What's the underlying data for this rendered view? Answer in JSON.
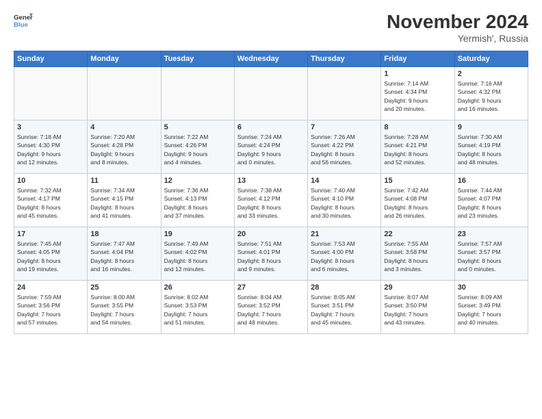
{
  "logo": {
    "line1": "General",
    "line2": "Blue"
  },
  "title": "November 2024",
  "subtitle": "Yermish', Russia",
  "days_of_week": [
    "Sunday",
    "Monday",
    "Tuesday",
    "Wednesday",
    "Thursday",
    "Friday",
    "Saturday"
  ],
  "weeks": [
    [
      {
        "num": "",
        "info": ""
      },
      {
        "num": "",
        "info": ""
      },
      {
        "num": "",
        "info": ""
      },
      {
        "num": "",
        "info": ""
      },
      {
        "num": "",
        "info": ""
      },
      {
        "num": "1",
        "info": "Sunrise: 7:14 AM\nSunset: 4:34 PM\nDaylight: 9 hours\nand 20 minutes."
      },
      {
        "num": "2",
        "info": "Sunrise: 7:16 AM\nSunset: 4:32 PM\nDaylight: 9 hours\nand 16 minutes."
      }
    ],
    [
      {
        "num": "3",
        "info": "Sunrise: 7:18 AM\nSunset: 4:30 PM\nDaylight: 9 hours\nand 12 minutes."
      },
      {
        "num": "4",
        "info": "Sunrise: 7:20 AM\nSunset: 4:28 PM\nDaylight: 9 hours\nand 8 minutes."
      },
      {
        "num": "5",
        "info": "Sunrise: 7:22 AM\nSunset: 4:26 PM\nDaylight: 9 hours\nand 4 minutes."
      },
      {
        "num": "6",
        "info": "Sunrise: 7:24 AM\nSunset: 4:24 PM\nDaylight: 9 hours\nand 0 minutes."
      },
      {
        "num": "7",
        "info": "Sunrise: 7:26 AM\nSunset: 4:22 PM\nDaylight: 8 hours\nand 56 minutes."
      },
      {
        "num": "8",
        "info": "Sunrise: 7:28 AM\nSunset: 4:21 PM\nDaylight: 8 hours\nand 52 minutes."
      },
      {
        "num": "9",
        "info": "Sunrise: 7:30 AM\nSunset: 4:19 PM\nDaylight: 8 hours\nand 48 minutes."
      }
    ],
    [
      {
        "num": "10",
        "info": "Sunrise: 7:32 AM\nSunset: 4:17 PM\nDaylight: 8 hours\nand 45 minutes."
      },
      {
        "num": "11",
        "info": "Sunrise: 7:34 AM\nSunset: 4:15 PM\nDaylight: 8 hours\nand 41 minutes."
      },
      {
        "num": "12",
        "info": "Sunrise: 7:36 AM\nSunset: 4:13 PM\nDaylight: 8 hours\nand 37 minutes."
      },
      {
        "num": "13",
        "info": "Sunrise: 7:38 AM\nSunset: 4:12 PM\nDaylight: 8 hours\nand 33 minutes."
      },
      {
        "num": "14",
        "info": "Sunrise: 7:40 AM\nSunset: 4:10 PM\nDaylight: 8 hours\nand 30 minutes."
      },
      {
        "num": "15",
        "info": "Sunrise: 7:42 AM\nSunset: 4:08 PM\nDaylight: 8 hours\nand 26 minutes."
      },
      {
        "num": "16",
        "info": "Sunrise: 7:44 AM\nSunset: 4:07 PM\nDaylight: 8 hours\nand 23 minutes."
      }
    ],
    [
      {
        "num": "17",
        "info": "Sunrise: 7:45 AM\nSunset: 4:05 PM\nDaylight: 8 hours\nand 19 minutes."
      },
      {
        "num": "18",
        "info": "Sunrise: 7:47 AM\nSunset: 4:04 PM\nDaylight: 8 hours\nand 16 minutes."
      },
      {
        "num": "19",
        "info": "Sunrise: 7:49 AM\nSunset: 4:02 PM\nDaylight: 8 hours\nand 12 minutes."
      },
      {
        "num": "20",
        "info": "Sunrise: 7:51 AM\nSunset: 4:01 PM\nDaylight: 8 hours\nand 9 minutes."
      },
      {
        "num": "21",
        "info": "Sunrise: 7:53 AM\nSunset: 4:00 PM\nDaylight: 8 hours\nand 6 minutes."
      },
      {
        "num": "22",
        "info": "Sunrise: 7:55 AM\nSunset: 3:58 PM\nDaylight: 8 hours\nand 3 minutes."
      },
      {
        "num": "23",
        "info": "Sunrise: 7:57 AM\nSunset: 3:57 PM\nDaylight: 8 hours\nand 0 minutes."
      }
    ],
    [
      {
        "num": "24",
        "info": "Sunrise: 7:59 AM\nSunset: 3:56 PM\nDaylight: 7 hours\nand 57 minutes."
      },
      {
        "num": "25",
        "info": "Sunrise: 8:00 AM\nSunset: 3:55 PM\nDaylight: 7 hours\nand 54 minutes."
      },
      {
        "num": "26",
        "info": "Sunrise: 8:02 AM\nSunset: 3:53 PM\nDaylight: 7 hours\nand 51 minutes."
      },
      {
        "num": "27",
        "info": "Sunrise: 8:04 AM\nSunset: 3:52 PM\nDaylight: 7 hours\nand 48 minutes."
      },
      {
        "num": "28",
        "info": "Sunrise: 8:05 AM\nSunset: 3:51 PM\nDaylight: 7 hours\nand 45 minutes."
      },
      {
        "num": "29",
        "info": "Sunrise: 8:07 AM\nSunset: 3:50 PM\nDaylight: 7 hours\nand 43 minutes."
      },
      {
        "num": "30",
        "info": "Sunrise: 8:09 AM\nSunset: 3:49 PM\nDaylight: 7 hours\nand 40 minutes."
      }
    ]
  ]
}
